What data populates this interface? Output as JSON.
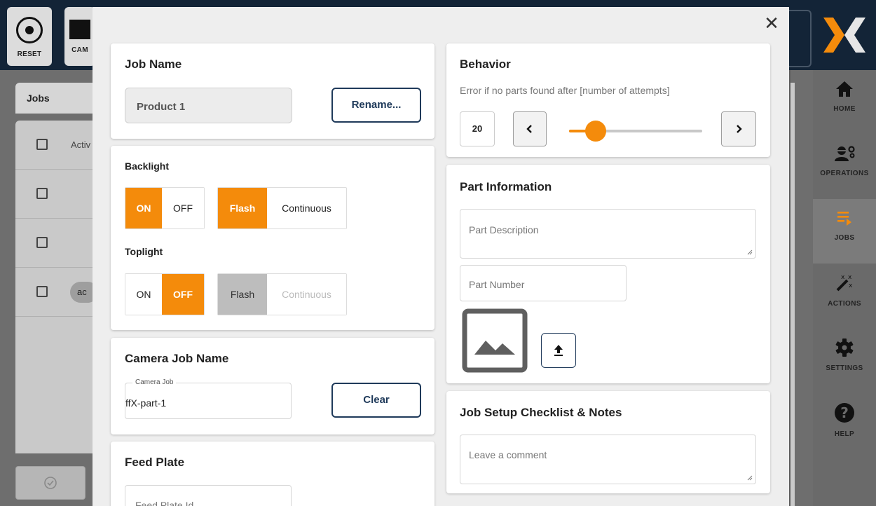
{
  "app": {
    "toolbar": {
      "reset_label": "RESET",
      "camera_label": "CAM"
    },
    "left_panel": {
      "tab_label": "Jobs",
      "header_text": "Activ",
      "pill_text": "ac"
    },
    "nav": {
      "items": [
        {
          "label": "HOME",
          "icon": "home-icon"
        },
        {
          "label": "OPERATIONS",
          "icon": "operations-icon"
        },
        {
          "label": "JOBS",
          "icon": "jobs-icon"
        },
        {
          "label": "ACTIONS",
          "icon": "actions-icon"
        },
        {
          "label": "SETTINGS",
          "icon": "settings-icon"
        },
        {
          "label": "HELP",
          "icon": "help-icon"
        }
      ]
    }
  },
  "modal": {
    "close_glyph": "✕",
    "job_name": {
      "title": "Job Name",
      "value": "Product 1",
      "rename_label": "Rename..."
    },
    "lights": {
      "backlight_title": "Backlight",
      "backlight_on_label": "ON",
      "backlight_off_label": "OFF",
      "backlight_state": "ON",
      "backlight_flash_label": "Flash",
      "backlight_continuous_label": "Continuous",
      "backlight_mode": "Flash",
      "toplight_title": "Toplight",
      "toplight_on_label": "ON",
      "toplight_off_label": "OFF",
      "toplight_state": "OFF",
      "toplight_flash_label": "Flash",
      "toplight_continuous_label": "Continuous",
      "toplight_mode": "Flash (disabled)"
    },
    "camera_job": {
      "title": "Camera Job Name",
      "field_label": "Camera Job",
      "value": "ffX-part-1",
      "clear_label": "Clear"
    },
    "feed_plate": {
      "title": "Feed Plate",
      "placeholder": "Feed Plate Id"
    },
    "behavior": {
      "title": "Behavior",
      "description": "Error if no parts found after [number of attempts]",
      "attempts": "20",
      "slider_fraction": 0.2
    },
    "part_info": {
      "title": "Part Information",
      "description_placeholder": "Part Description",
      "number_placeholder": "Part Number"
    },
    "checklist": {
      "title": "Job Setup Checklist & Notes",
      "comment_placeholder": "Leave a comment"
    }
  },
  "colors": {
    "accent": "#f48b0b",
    "navy": "#1f3a5a",
    "topbar": "#132437"
  }
}
